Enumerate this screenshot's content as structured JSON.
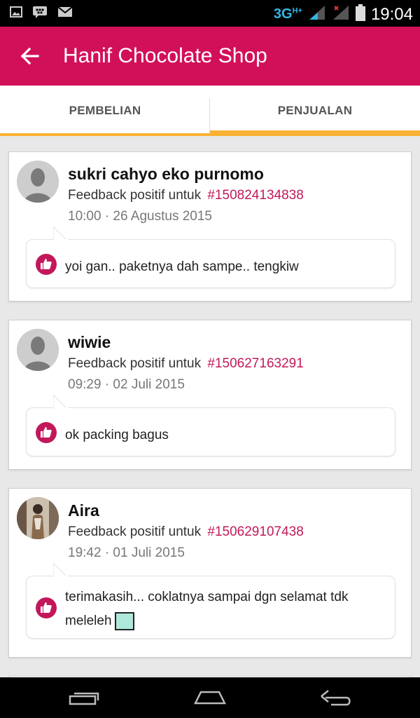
{
  "status_bar": {
    "network": "3G",
    "network_sup": "H+",
    "time": "19:04",
    "left_icons": [
      "image-icon",
      "bbm-icon",
      "mail-icon"
    ],
    "right_icons": [
      "signal-icon",
      "battery-icon"
    ]
  },
  "app_bar": {
    "title": "Hanif Chocolate Shop",
    "back_icon": "arrow-back-icon",
    "color": "#d2105a"
  },
  "tabs": [
    {
      "label": "PEMBELIAN"
    },
    {
      "label": "PENJUALAN"
    }
  ],
  "tab_accent_color": "#f9b233",
  "feedback_items": [
    {
      "name": "sukri cahyo eko purnomo",
      "feedback_prefix": "Feedback positif untuk",
      "order_id": "#150824134838",
      "timestamp": "10:00 · 26 Agustus 2015",
      "comment": "yoi gan.. paketnya dah sampe.. tengkiw",
      "rating_icon": "thumbs-up-icon"
    },
    {
      "name": "wiwie",
      "feedback_prefix": "Feedback positif untuk",
      "order_id": "#150627163291",
      "timestamp": "09:29 · 02 Juli 2015",
      "comment": "ok packing bagus",
      "rating_icon": "thumbs-up-icon"
    },
    {
      "name": "Aira",
      "feedback_prefix": "Feedback positif untuk",
      "order_id": "#150629107438",
      "timestamp": "19:42 · 01 Juli 2015",
      "comment": "terimakasih... coklatnya sampai dgn selamat tdk meleleh",
      "rating_icon": "thumbs-up-icon"
    }
  ],
  "link_color": "#c2185b",
  "nav_bar": {
    "buttons": [
      "recent-apps-icon",
      "home-icon",
      "back-icon"
    ]
  }
}
